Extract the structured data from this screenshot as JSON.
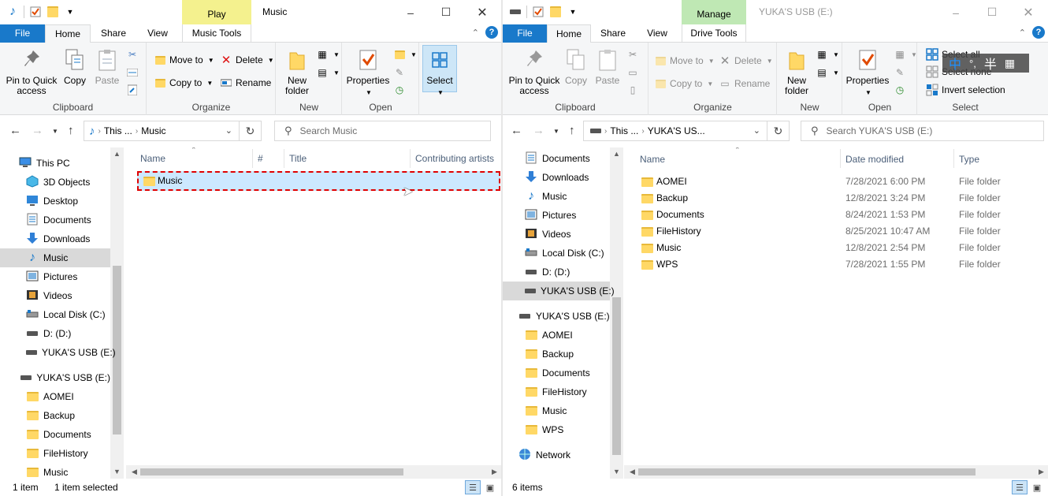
{
  "left": {
    "context_tab": "Play",
    "title": "Music",
    "tabs": {
      "file": "File",
      "home": "Home",
      "share": "Share",
      "view": "View",
      "tools": "Music Tools"
    },
    "ribbon": {
      "clipboard": {
        "pin": "Pin to Quick access",
        "copy": "Copy",
        "paste": "Paste",
        "label": "Clipboard"
      },
      "organize": {
        "move_to": "Move to",
        "copy_to": "Copy to",
        "delete": "Delete",
        "rename": "Rename",
        "label": "Organize"
      },
      "new": {
        "new_folder": "New folder",
        "label": "New"
      },
      "open": {
        "properties": "Properties",
        "label": "Open"
      },
      "select": {
        "select": "Select"
      }
    },
    "address": {
      "crumb1": "This ...",
      "crumb2": "Music"
    },
    "search_placeholder": "Search Music",
    "nav": [
      "This PC",
      "3D Objects",
      "Desktop",
      "Documents",
      "Downloads",
      "Music",
      "Pictures",
      "Videos",
      "Local Disk (C:)",
      "D: (D:)",
      "YUKA'S USB (E:)",
      "YUKA'S USB (E:)",
      "AOMEI",
      "Backup",
      "Documents",
      "FileHistory",
      "Music"
    ],
    "columns": {
      "name": "Name",
      "num": "#",
      "title": "Title",
      "artists": "Contributing artists"
    },
    "items": [
      {
        "name": "Music"
      }
    ],
    "status": {
      "count": "1 item",
      "selected": "1 item selected"
    }
  },
  "right": {
    "context_tab": "Manage",
    "title": "YUKA'S USB (E:)",
    "tabs": {
      "file": "File",
      "home": "Home",
      "share": "Share",
      "view": "View",
      "tools": "Drive Tools"
    },
    "ribbon": {
      "clipboard": {
        "pin": "Pin to Quick access",
        "copy": "Copy",
        "paste": "Paste",
        "label": "Clipboard"
      },
      "organize": {
        "move_to": "Move to",
        "copy_to": "Copy to",
        "delete": "Delete",
        "rename": "Rename",
        "label": "Organize"
      },
      "new": {
        "new_folder": "New folder",
        "label": "New"
      },
      "open": {
        "properties": "Properties",
        "label": "Open"
      },
      "select": {
        "select_all": "Select all",
        "select_none": "Select none",
        "invert": "Invert selection",
        "label": "Select"
      }
    },
    "address": {
      "crumb1": "This ...",
      "crumb2": "YUKA'S US..."
    },
    "search_placeholder": "Search YUKA'S USB (E:)",
    "nav": [
      "Documents",
      "Downloads",
      "Music",
      "Pictures",
      "Videos",
      "Local Disk (C:)",
      "D: (D:)",
      "YUKA'S USB (E:)",
      "YUKA'S USB (E:)",
      "AOMEI",
      "Backup",
      "Documents",
      "FileHistory",
      "Music",
      "WPS",
      "Network"
    ],
    "columns": {
      "name": "Name",
      "date": "Date modified",
      "type": "Type"
    },
    "items": [
      {
        "name": "AOMEI",
        "date": "7/28/2021 6:00 PM",
        "type": "File folder"
      },
      {
        "name": "Backup",
        "date": "12/8/2021 3:24 PM",
        "type": "File folder"
      },
      {
        "name": "Documents",
        "date": "8/24/2021 1:53 PM",
        "type": "File folder"
      },
      {
        "name": "FileHistory",
        "date": "8/25/2021 10:47 AM",
        "type": "File folder"
      },
      {
        "name": "Music",
        "date": "12/8/2021 2:54 PM",
        "type": "File folder"
      },
      {
        "name": "WPS",
        "date": "7/28/2021 1:55 PM",
        "type": "File folder"
      }
    ],
    "status": {
      "count": "6 items"
    }
  },
  "ime": {
    "mode": "中",
    "punct": "°,",
    "width": "半"
  },
  "colors": {
    "accent": "#1979ca",
    "play_tab": "#f4f18e",
    "manage_tab": "#bfe8b4",
    "selection": "#cce8ff",
    "highlight_border": "#e00000"
  }
}
